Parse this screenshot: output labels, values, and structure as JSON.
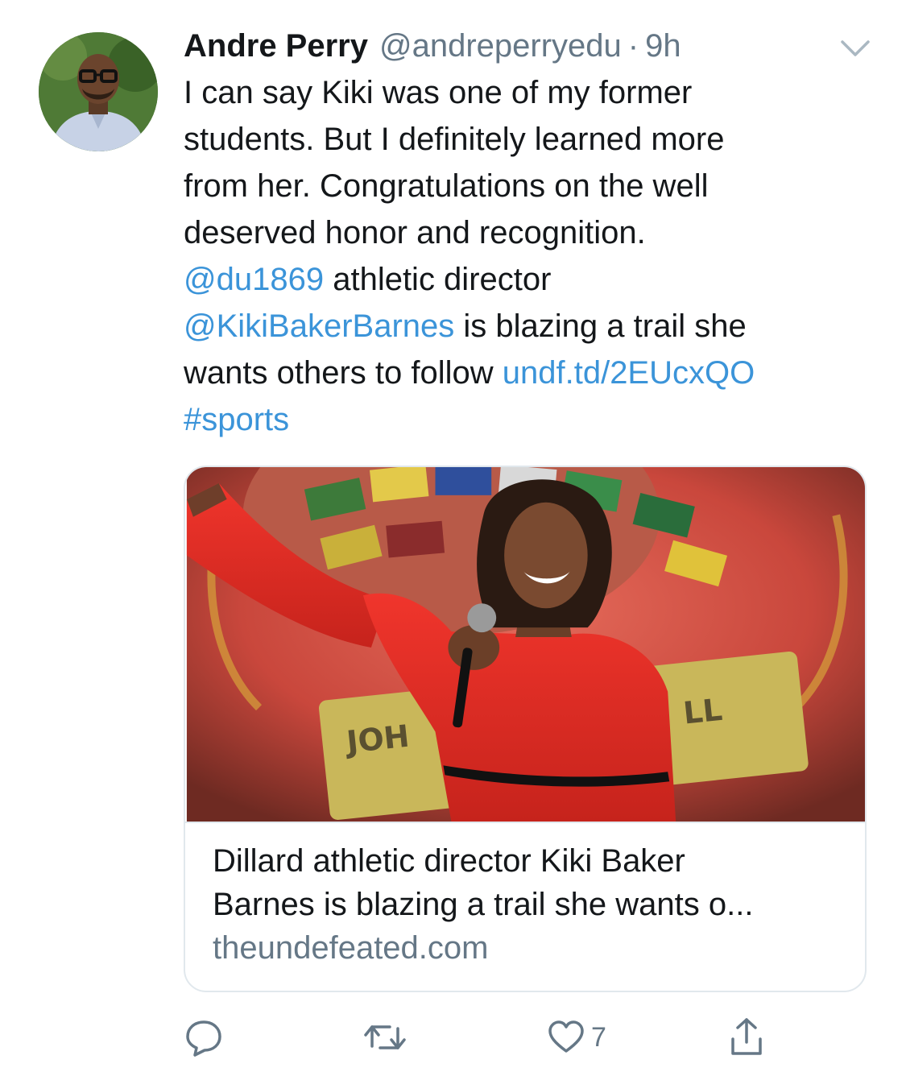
{
  "tweet": {
    "author_name": "Andre Perry",
    "author_handle": "@andreperryedu",
    "separator": "·",
    "timestamp": "9h",
    "body": {
      "line1": "I can say Kiki was one of my former",
      "line2": "students. But I definitely learned more",
      "line3": "from her. Congratulations on the well",
      "line4": "deserved honor and recognition.",
      "mention1": "@du1869",
      "line5_rest": " athletic director",
      "mention2": "@KikiBakerBarnes",
      "line6_rest": " is blazing a trail she",
      "line7_start": "wants others to follow ",
      "url": "undf.td/2EUcxQO",
      "hashtag": "#sports"
    }
  },
  "card": {
    "title_line1": "Dillard athletic director Kiki Baker",
    "title_line2": "Barnes is blazing a trail she wants o...",
    "domain": "theundefeated.com",
    "image_text_left": "JOH",
    "image_text_right": "LL"
  },
  "actions": {
    "reply_icon": "reply-icon",
    "retweet_icon": "retweet-icon",
    "like_icon": "heart-icon",
    "like_count": "7",
    "share_icon": "share-icon"
  },
  "colors": {
    "link": "#3b94d9",
    "secondary_text": "#657786",
    "primary_text": "#14171a",
    "border": "#e1e8ed"
  }
}
